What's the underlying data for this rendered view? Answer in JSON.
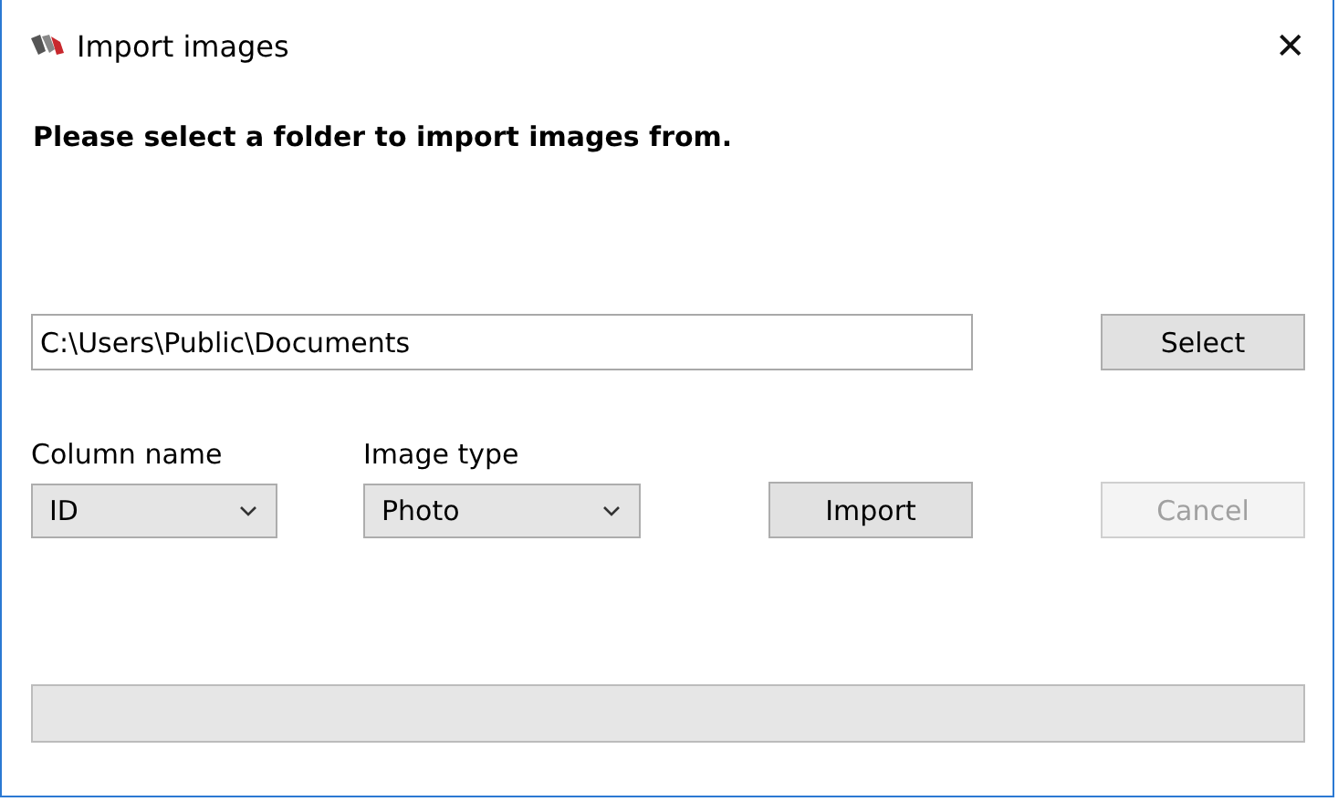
{
  "window": {
    "title": "Import images",
    "close": "✕"
  },
  "instruction": "Please select a folder to import images from.",
  "folder_field": {
    "value": "C:\\Users\\Public\\Documents"
  },
  "select_button": {
    "label": "Select",
    "disabled": false
  },
  "column_name": {
    "label": "Column name",
    "value": "ID"
  },
  "image_type": {
    "label": "Image type",
    "value": "Photo"
  },
  "import_button": {
    "label": "Import",
    "disabled": false
  },
  "cancel_button": {
    "label": "Cancel",
    "disabled": true
  },
  "progress": {
    "level": 0
  }
}
